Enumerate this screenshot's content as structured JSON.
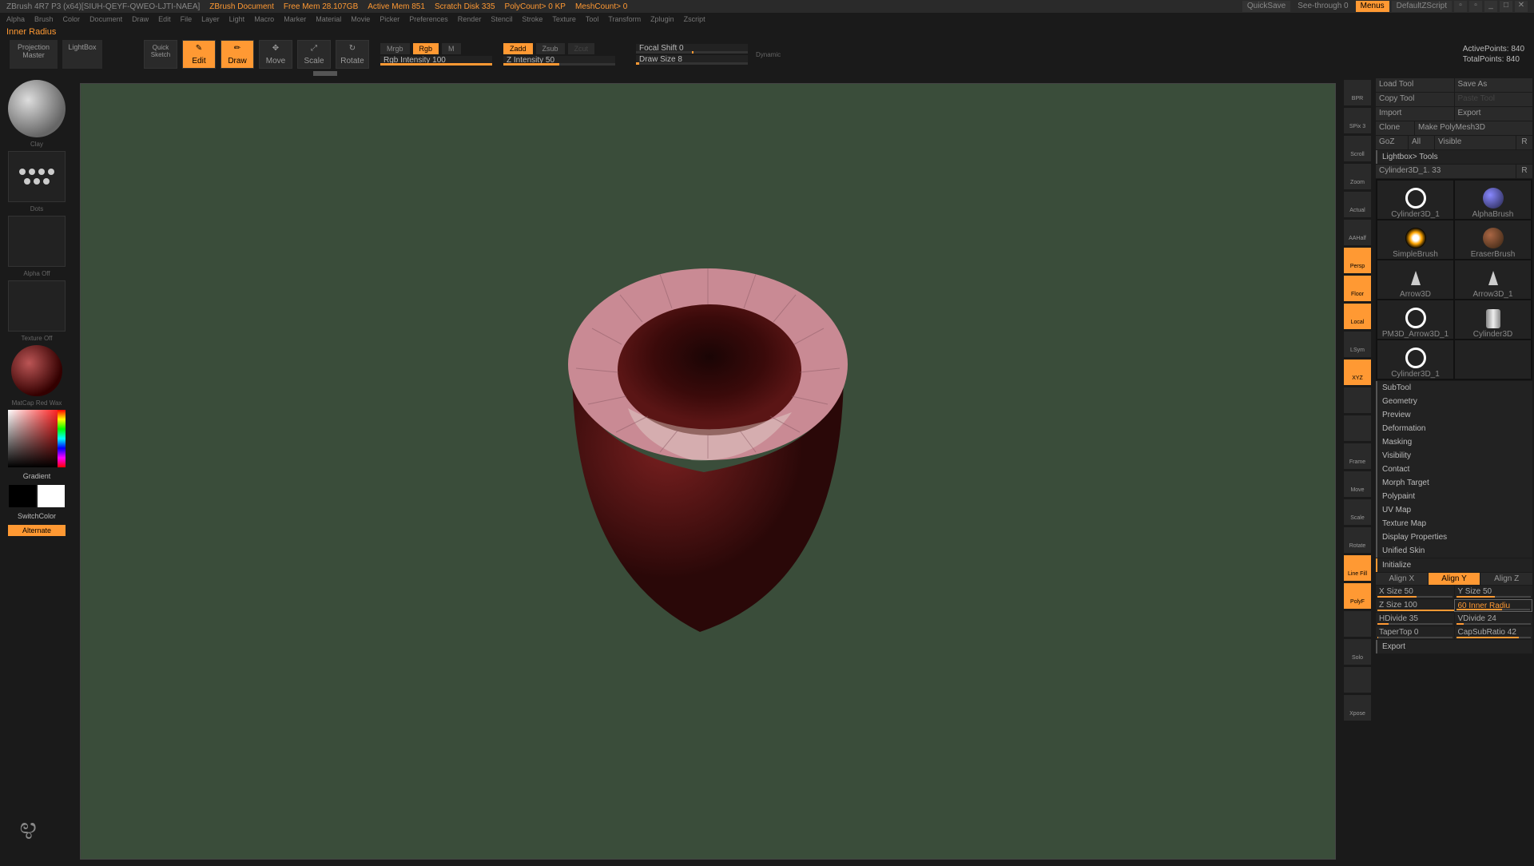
{
  "titlebar": {
    "app": "ZBrush 4R7 P3 (x64)[SIUH-QEYF-QWEO-LJTI-NAEA]",
    "doc": "ZBrush Document",
    "free_mem": "Free Mem 28.107GB",
    "active_mem": "Active Mem 851",
    "scratch": "Scratch Disk 335",
    "polycount": "PolyCount> 0 KP",
    "meshcount": "MeshCount> 0",
    "quicksave": "QuickSave",
    "seethrough": "See-through  0",
    "menus": "Menus",
    "script": "DefaultZScript"
  },
  "menubar": [
    "Alpha",
    "Brush",
    "Color",
    "Document",
    "Draw",
    "Edit",
    "File",
    "Layer",
    "Light",
    "Macro",
    "Marker",
    "Material",
    "Movie",
    "Picker",
    "Preferences",
    "Render",
    "Stencil",
    "Stroke",
    "Texture",
    "Tool",
    "Transform",
    "Zplugin",
    "Zscript"
  ],
  "hint": "Inner Radius",
  "toolbar": {
    "projection": "Projection\nMaster",
    "lightbox": "LightBox",
    "quicksketch": "Quick\nSketch",
    "edit": "Edit",
    "draw": "Draw",
    "move": "Move",
    "scale": "Scale",
    "rotate": "Rotate",
    "mrgb": "Mrgb",
    "rgb": "Rgb",
    "m": "M",
    "intensity": "Rgb Intensity 100",
    "zadd": "Zadd",
    "zsub": "Zsub",
    "zcut": "Zcut",
    "zintensity": "Z Intensity 50",
    "focal": "Focal Shift 0",
    "drawsize": "Draw Size 8",
    "dynamic": "Dynamic",
    "active_pts": "ActivePoints: 840",
    "total_pts": "TotalPoints: 840"
  },
  "left": {
    "brush_label": "Clay",
    "stroke_label": "Dots",
    "alpha_label": "Alpha Off",
    "texture_label": "Texture Off",
    "material_label": "MatCap Red Wax",
    "gradient": "Gradient",
    "switch": "SwitchColor",
    "alternate": "Alternate"
  },
  "right_strip": [
    "BPR",
    "SPix 3",
    "Scroll",
    "Zoom",
    "Actual",
    "AAHalf",
    "Persp",
    "Floor",
    "Local",
    "LSym",
    "XYZ",
    "",
    "",
    "Frame",
    "Move",
    "Scale",
    "Rotate",
    "Line Fill",
    "PolyF",
    "",
    "Solo",
    "",
    "Xpose"
  ],
  "right_strip_active": [
    6,
    7,
    8,
    10,
    17,
    18
  ],
  "panel": {
    "load_tool": "Load Tool",
    "save_as": "Save As",
    "copy_tool": "Copy Tool",
    "paste_tool": "Paste Tool",
    "import": "Import",
    "export": "Export",
    "clone": "Clone",
    "make_poly": "Make PolyMesh3D",
    "goz": "GoZ",
    "all": "All",
    "visible": "Visible",
    "r": "R",
    "lightbox_tools": "Lightbox> Tools",
    "current_tool": "Cylinder3D_1. 33",
    "tools": [
      [
        "Cylinder3D_1",
        "AlphaBrush"
      ],
      [
        "SimpleBrush",
        "EraserBrush"
      ],
      [
        "Arrow3D",
        "Arrow3D_1"
      ],
      [
        "PM3D_Arrow3D_1",
        "Cylinder3D"
      ],
      [
        "Cylinder3D_1",
        ""
      ]
    ],
    "sections": [
      "SubTool",
      "Geometry",
      "Preview",
      "Deformation",
      "Masking",
      "Visibility",
      "Contact",
      "Morph Target",
      "Polypaint",
      "UV Map",
      "Texture Map",
      "Display Properties",
      "Unified Skin"
    ],
    "initialize": "Initialize",
    "align_x": "Align X",
    "align_y": "Align Y",
    "align_z": "Align Z",
    "xsize": "X Size 50",
    "ysize": "Y Size 50",
    "zsize": "Z Size 100",
    "inner_r": "60 Inner Radiu",
    "hdiv": "HDivide 35",
    "vdiv": "VDivide 24",
    "taper": "TaperTop 0",
    "capsub": "CapSubRatio 42",
    "export2": "Export"
  }
}
